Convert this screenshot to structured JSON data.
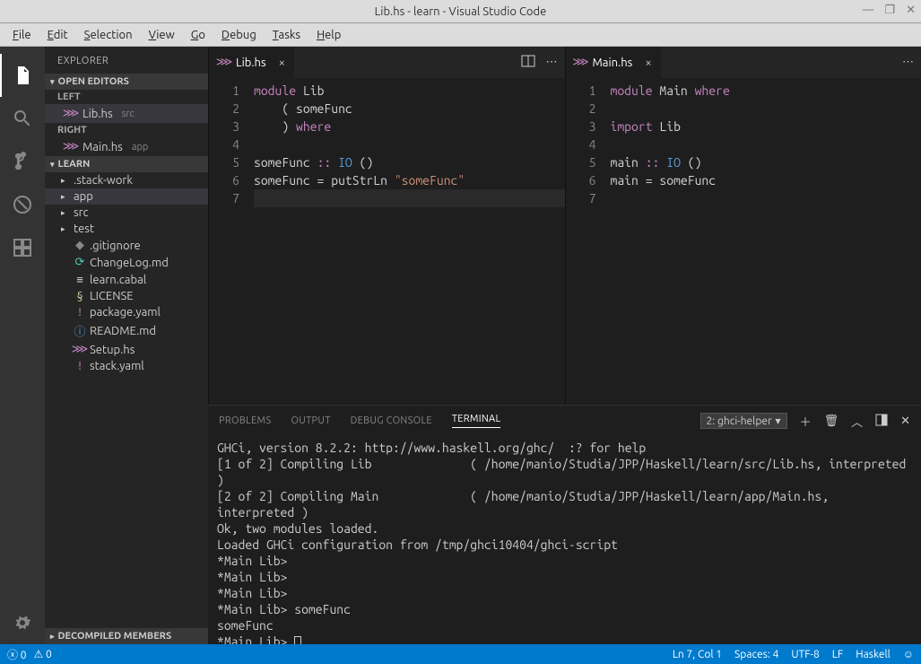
{
  "window_title": "Lib.hs - learn - Visual Studio Code",
  "menu": [
    "File",
    "Edit",
    "Selection",
    "View",
    "Go",
    "Debug",
    "Tasks",
    "Help"
  ],
  "sidebar": {
    "title": "EXPLORER",
    "open_editors_label": "OPEN EDITORS",
    "left_label": "LEFT",
    "right_label": "RIGHT",
    "open_left": {
      "name": "Lib.hs",
      "path": "src"
    },
    "open_right": {
      "name": "Main.hs",
      "path": "app"
    },
    "project_label": "LEARN",
    "tree": [
      {
        "name": ".stack-work",
        "type": "folder"
      },
      {
        "name": "app",
        "type": "folder",
        "selected": true
      },
      {
        "name": "src",
        "type": "folder"
      },
      {
        "name": "test",
        "type": "folder"
      },
      {
        "name": ".gitignore",
        "type": "file",
        "iconColor": "gray",
        "glyph": "◆"
      },
      {
        "name": "ChangeLog.md",
        "type": "file",
        "iconColor": "teal",
        "glyph": "⟳"
      },
      {
        "name": "learn.cabal",
        "type": "file",
        "iconColor": "white",
        "glyph": "≡"
      },
      {
        "name": "LICENSE",
        "type": "file",
        "iconColor": "yellow",
        "glyph": "§"
      },
      {
        "name": "package.yaml",
        "type": "file",
        "iconColor": "purple",
        "glyph": "!"
      },
      {
        "name": "README.md",
        "type": "file",
        "iconColor": "blue",
        "glyph": "ⓘ"
      },
      {
        "name": "Setup.hs",
        "type": "file",
        "iconColor": "purple",
        "glyph": "⋙"
      },
      {
        "name": "stack.yaml",
        "type": "file",
        "iconColor": "purple",
        "glyph": "!"
      }
    ],
    "decompiled_label": "DECOMPILED MEMBERS"
  },
  "editors": {
    "left": {
      "tab": "Lib.hs",
      "lines": [
        [
          {
            "t": "module ",
            "c": "kw"
          },
          {
            "t": "Lib",
            "c": "ident"
          }
        ],
        [
          {
            "t": "    ( someFunc",
            "c": "ident"
          }
        ],
        [
          {
            "t": "    ) ",
            "c": "ident"
          },
          {
            "t": "where",
            "c": "kw"
          }
        ],
        [
          {
            "t": "",
            "c": ""
          }
        ],
        [
          {
            "t": "someFunc ",
            "c": "ident"
          },
          {
            "t": ":: ",
            "c": "kw"
          },
          {
            "t": "IO",
            "c": "type"
          },
          {
            "t": " ()",
            "c": "ident"
          }
        ],
        [
          {
            "t": "someFunc = putStrLn ",
            "c": "ident"
          },
          {
            "t": "\"someFunc\"",
            "c": "str"
          }
        ],
        [
          {
            "t": "",
            "c": ""
          }
        ]
      ]
    },
    "right": {
      "tab": "Main.hs",
      "lines": [
        [
          {
            "t": "module ",
            "c": "kw"
          },
          {
            "t": "Main ",
            "c": "ident"
          },
          {
            "t": "where",
            "c": "kw"
          }
        ],
        [
          {
            "t": "",
            "c": ""
          }
        ],
        [
          {
            "t": "import ",
            "c": "kw"
          },
          {
            "t": "Lib",
            "c": "ident"
          }
        ],
        [
          {
            "t": "",
            "c": ""
          }
        ],
        [
          {
            "t": "main ",
            "c": "ident"
          },
          {
            "t": ":: ",
            "c": "kw"
          },
          {
            "t": "IO",
            "c": "type"
          },
          {
            "t": " ()",
            "c": "ident"
          }
        ],
        [
          {
            "t": "main = someFunc",
            "c": "ident"
          }
        ],
        [
          {
            "t": "",
            "c": ""
          }
        ]
      ]
    }
  },
  "panel": {
    "tabs": [
      "PROBLEMS",
      "OUTPUT",
      "DEBUG CONSOLE",
      "TERMINAL"
    ],
    "active_tab": "TERMINAL",
    "selector": "2: ghci-helper",
    "terminal_lines": [
      "GHCi, version 8.2.2: http://www.haskell.org/ghc/  :? for help",
      "[1 of 2] Compiling Lib              ( /home/manio/Studia/JPP/Haskell/learn/src/Lib.hs, interpreted )",
      "[2 of 2] Compiling Main             ( /home/manio/Studia/JPP/Haskell/learn/app/Main.hs, interpreted )",
      "Ok, two modules loaded.",
      "Loaded GHCi configuration from /tmp/ghci10404/ghci-script",
      "*Main Lib>",
      "*Main Lib>",
      "*Main Lib>",
      "*Main Lib> someFunc",
      "someFunc",
      "*Main Lib> "
    ]
  },
  "status": {
    "errors": "0",
    "warnings": "0",
    "cursor": "Ln 7, Col 1",
    "spaces": "Spaces: 4",
    "encoding": "UTF-8",
    "eol": "LF",
    "lang": "Haskell"
  }
}
